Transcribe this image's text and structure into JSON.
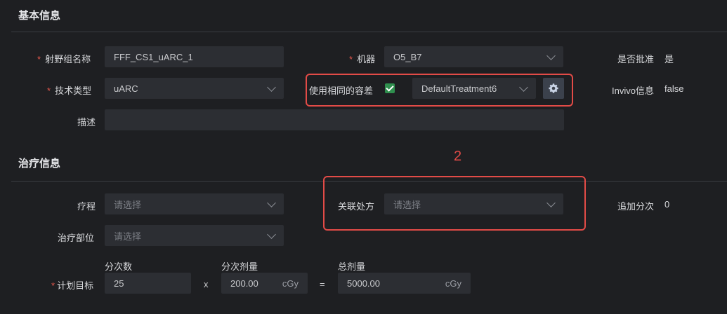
{
  "basic_info": {
    "title": "基本信息",
    "plan_group_name_label": "射野组名称",
    "plan_group_name_value": "FFF_CS1_uARC_1",
    "machine_label": "机器",
    "machine_value": "O5_B7",
    "approved_label": "是否批准",
    "approved_value": "是",
    "technique_label": "技术类型",
    "technique_value": "uARC",
    "same_tolerance_label": "使用相同的容差",
    "same_tolerance_checked": true,
    "tolerance_value": "DefaultTreatment6",
    "invivo_label": "Invivo信息",
    "invivo_value": "false",
    "description_label": "描述",
    "description_value": ""
  },
  "treatment_info": {
    "title": "治疗信息",
    "course_label": "疗程",
    "course_placeholder": "请选择",
    "linked_rx_label": "关联处方",
    "linked_rx_placeholder": "请选择",
    "extra_fraction_label": "追加分次",
    "extra_fraction_value": "0",
    "site_label": "治疗部位",
    "site_placeholder": "请选择",
    "fractions_header": "分次数",
    "fraction_dose_header": "分次剂量",
    "total_dose_header": "总剂量",
    "plan_target_label": "计划目标",
    "fractions_value": "25",
    "times_sign": "x",
    "fraction_dose_value": "200.00",
    "fraction_dose_unit": "cGy",
    "equals_sign": "=",
    "total_dose_value": "5000.00",
    "total_dose_unit": "cGy"
  },
  "annotation": {
    "number_label": "2",
    "highlight_color": "#e24b47"
  },
  "required_mark": "*"
}
